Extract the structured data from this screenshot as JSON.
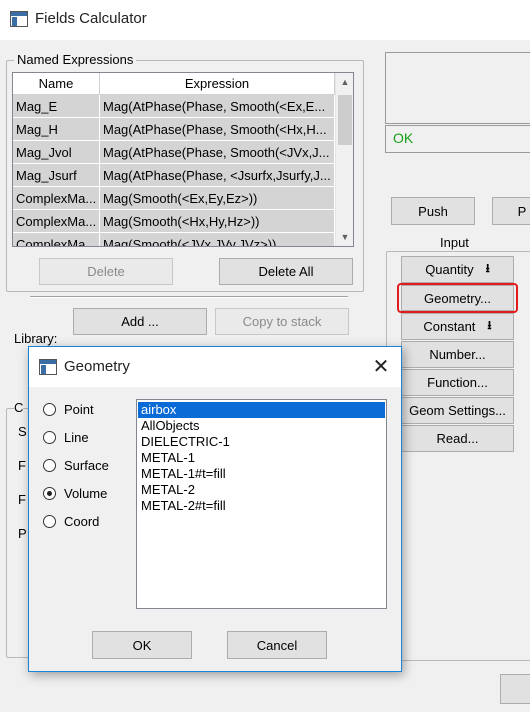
{
  "window": {
    "title": "Fields Calculator"
  },
  "named_expressions": {
    "label": "Named Expressions",
    "columns": [
      "Name",
      "Expression"
    ],
    "rows": [
      {
        "name": "Mag_E",
        "expression": "Mag(AtPhase(Phase, Smooth(<Ex,E..."
      },
      {
        "name": "Mag_H",
        "expression": "Mag(AtPhase(Phase, Smooth(<Hx,H..."
      },
      {
        "name": "Mag_Jvol",
        "expression": "Mag(AtPhase(Phase, Smooth(<JVx,J..."
      },
      {
        "name": "Mag_Jsurf",
        "expression": "Mag(AtPhase(Phase, <Jsurfx,Jsurfy,J..."
      },
      {
        "name": "ComplexMa...",
        "expression": "Mag(Smooth(<Ex,Ey,Ez>))"
      },
      {
        "name": "ComplexMa...",
        "expression": "Mag(Smooth(<Hx,Hy,Hz>))"
      },
      {
        "name": "ComplexMa...",
        "expression": "Mag(Smooth(<JVx,JVy,JVz>))"
      }
    ],
    "delete_label": "Delete",
    "delete_all_label": "Delete All",
    "add_label": "Add ...",
    "copy_to_stack_label": "Copy to stack",
    "library_label": "Library:"
  },
  "left_hidden_labels": [
    "C",
    "S",
    "F",
    "F",
    "P"
  ],
  "status": {
    "text": "OK",
    "color": "#1aa01a"
  },
  "stack": {
    "push_label": "Push",
    "next_label": "P"
  },
  "input": {
    "label": "Input",
    "buttons": [
      {
        "label": "Quantity",
        "icon": "down-arrow-icon"
      },
      {
        "label": "Geometry...",
        "highlighted": true
      },
      {
        "label": "Constant",
        "icon": "down-arrow-icon"
      },
      {
        "label": "Number..."
      },
      {
        "label": "Function..."
      },
      {
        "label": "Geom Settings..."
      },
      {
        "label": "Read..."
      }
    ],
    "highlight_color": "#e21c1c"
  },
  "dialog": {
    "title": "Geometry",
    "radios": [
      {
        "label": "Point",
        "checked": false
      },
      {
        "label": "Line",
        "checked": false
      },
      {
        "label": "Surface",
        "checked": false
      },
      {
        "label": "Volume",
        "checked": true
      },
      {
        "label": "Coord",
        "checked": false
      }
    ],
    "list_items": [
      "airbox",
      "AllObjects",
      "DIELECTRIC-1",
      "METAL-1",
      "METAL-1#t=fill",
      "METAL-2",
      "METAL-2#t=fill"
    ],
    "selected_item": "airbox",
    "ok_label": "OK",
    "cancel_label": "Cancel",
    "selection_color": "#0a6ad6"
  }
}
